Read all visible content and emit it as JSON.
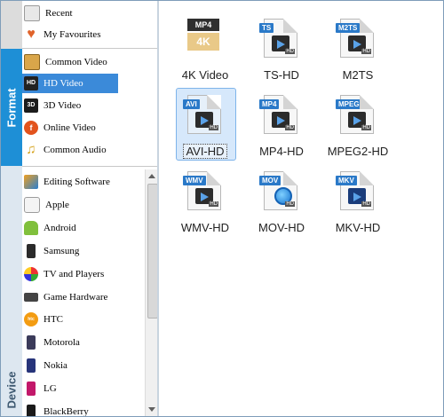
{
  "tabs": {
    "format_label": "Format",
    "device_label": "Device"
  },
  "list": {
    "items": [
      {
        "label": "Recent",
        "icon": "recent-icon"
      },
      {
        "label": "My Favourites",
        "icon": "heart-icon"
      },
      {
        "label": "Common Video",
        "icon": "film-icon"
      },
      {
        "label": "HD Video",
        "icon": "hd-icon",
        "selected": true
      },
      {
        "label": "3D Video",
        "icon": "3d-icon"
      },
      {
        "label": "Online Video",
        "icon": "online-video-icon"
      },
      {
        "label": "Common Audio",
        "icon": "music-note-icon"
      },
      {
        "label": "Editing Software",
        "icon": "editing-software-icon"
      },
      {
        "label": "Apple",
        "icon": "apple-icon"
      },
      {
        "label": "Android",
        "icon": "android-icon"
      },
      {
        "label": "Samsung",
        "icon": "samsung-icon"
      },
      {
        "label": "TV and Players",
        "icon": "tv-players-icon"
      },
      {
        "label": "Game Hardware",
        "icon": "game-hardware-icon"
      },
      {
        "label": "HTC",
        "icon": "htc-icon"
      },
      {
        "label": "Motorola",
        "icon": "motorola-icon"
      },
      {
        "label": "Nokia",
        "icon": "nokia-icon"
      },
      {
        "label": "LG",
        "icon": "lg-icon"
      },
      {
        "label": "BlackBerry",
        "icon": "blackberry-icon"
      }
    ]
  },
  "formats": [
    {
      "label": "4K Video",
      "tag": "MP4",
      "badge": "4K",
      "icon": "mp4-4k-icon"
    },
    {
      "label": "TS-HD",
      "tag": "TS",
      "badge": "HD",
      "icon": "ts-hd-icon"
    },
    {
      "label": "M2TS",
      "tag": "M2TS",
      "badge": "HD",
      "icon": "m2ts-icon"
    },
    {
      "label": "AVI-HD",
      "tag": "AVI",
      "badge": "HD",
      "icon": "avi-hd-icon",
      "selected": true
    },
    {
      "label": "MP4-HD",
      "tag": "MP4",
      "badge": "HD",
      "icon": "mp4-hd-icon"
    },
    {
      "label": "MPEG2-HD",
      "tag": "MPEG",
      "badge": "HD",
      "icon": "mpeg2-hd-icon"
    },
    {
      "label": "WMV-HD",
      "tag": "WMV",
      "badge": "HD",
      "icon": "wmv-hd-icon"
    },
    {
      "label": "MOV-HD",
      "tag": "MOV",
      "badge": "HD",
      "icon": "mov-hd-icon"
    },
    {
      "label": "MKV-HD",
      "tag": "MKV",
      "badge": "HD",
      "icon": "mkv-hd-icon"
    }
  ],
  "colors": {
    "format_tab": "#1e8fd6",
    "device_tab": "#dde7f0",
    "selection": "#3b8ad9"
  }
}
